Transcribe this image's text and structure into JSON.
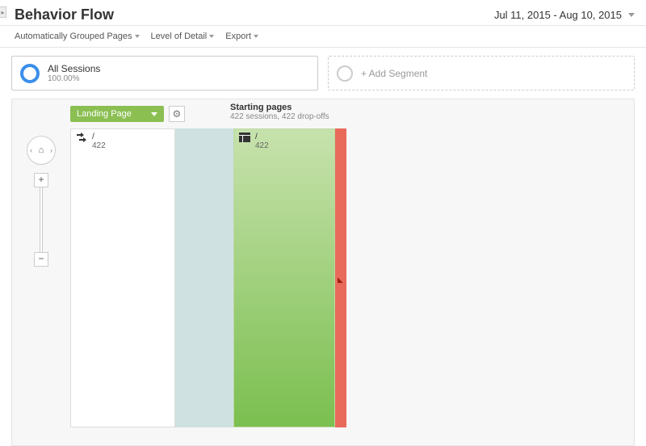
{
  "header": {
    "title": "Behavior Flow",
    "date_range": "Jul 11, 2015 - Aug 10, 2015"
  },
  "toolbar": {
    "grouping": "Automatically Grouped Pages",
    "level_of_detail": "Level of Detail",
    "export": "Export"
  },
  "segments": {
    "primary": {
      "title": "All Sessions",
      "sub": "100.00%"
    },
    "add_label": "+ Add Segment"
  },
  "dimension": {
    "selected": "Landing Page"
  },
  "zoom": {
    "plus": "+",
    "minus": "−"
  },
  "columns": {
    "start": {
      "title": "Starting pages",
      "sub": "422 sessions, 422 drop-offs"
    }
  },
  "nodes": {
    "source": {
      "path": "/",
      "count": "422"
    },
    "start": {
      "path": "/",
      "count": "422"
    }
  }
}
